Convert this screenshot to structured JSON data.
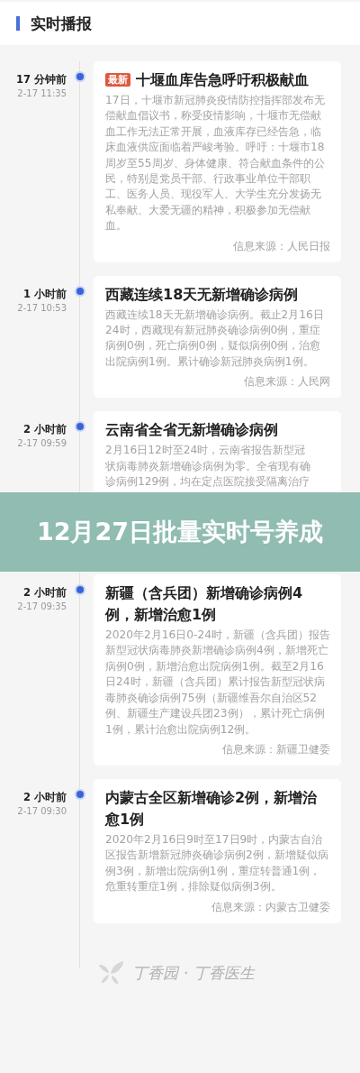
{
  "header": {
    "title": "实时播报"
  },
  "items": [
    {
      "time_ago": "17 分钟前",
      "timestamp": "2-17 11:35",
      "badge": "最新",
      "title": "十堰血库告急呼吁积极献血",
      "body_lines": [
        {
          "kind": "text",
          "text": "17日，十堰市新冠肺炎疫情防控指挥部发布无偿献血倡议书，称受疫情影响，十堰市无偿献血工作无法正常开展，血液库存已经告急，临床血液供应面临着严峻考验。呼吁：十堰市18周岁至55周岁、身体健康、符合献血条件的公民，特别是党员干部、行政事业单位干部职工、医务人员、现役军人、大学生充分发扬无私奉献、大爱无疆的精神，积极参加无偿献血。"
        }
      ],
      "source": "信息来源：人民日报"
    },
    {
      "time_ago": "1 小时前",
      "timestamp": "2-17 10:53",
      "title": "西藏连续18天无新增确诊病例",
      "body_lines": [
        {
          "kind": "text",
          "text": "西藏连续18天无新增确诊病例。截止2月16日24时，西藏现有新冠肺炎确诊病例0例，重症病例0例，死亡病例0例，疑似病例0例，治愈出院病例1例。累计确诊新冠肺炎病例1例。"
        }
      ],
      "source": "信息来源：人民网"
    },
    {
      "time_ago": "2 小时前",
      "timestamp": "2-17 09:59",
      "title": "云南省全省无新增确诊病例",
      "body_lines": [
        {
          "kind": "text",
          "text": " 2月16日12时至24时，云南省报告新型冠"
        },
        {
          "kind": "text",
          "text": "状病毒肺炎新增确诊病例为零。全省现有确"
        },
        {
          "kind": "text",
          "text": "诊病例129例，均在定点医院接受隔离治疗"
        },
        {
          "kind": "hidden"
        },
        {
          "kind": "hidden"
        },
        {
          "kind": "hidden"
        },
        {
          "kind": "hidden"
        }
      ]
    },
    {
      "time_ago": "2 小时前",
      "timestamp": "2-17 09:35",
      "title": "新疆（含兵团）新增确诊病例4例，新增治愈1例",
      "body_lines": [
        {
          "kind": "text",
          "text": "2020年2月16日0-24时，新疆（含兵团）报告新型冠状病毒肺炎新增确诊病例4例，新增死亡病例0例，新增治愈出院病例1例。截至2月16日24时，新疆（含兵团）累计报告新型冠状病毒肺炎确诊病例75例（新疆维吾尔自治区52例、新疆生产建设兵团23例），累计死亡病例1例，累计治愈出院病例12例。"
        }
      ],
      "source": "信息来源：新疆卫健委"
    },
    {
      "time_ago": "2 小时前",
      "timestamp": "2-17 09:30",
      "title": "内蒙古全区新增确诊2例，新增治愈1例",
      "body_lines": [
        {
          "kind": "text",
          "text": "2020年2月16日9时至17日9时，内蒙古自治区报告新增新冠肺炎确诊病例2例，新增疑似病例3例，新增出院病例1例，重症转普通1例，危重转重症1例，排除疑似病例3例。"
        }
      ],
      "source": "信息来源：内蒙古卫健委"
    }
  ],
  "footer": {
    "brand": "丁香园 · 丁香医生"
  },
  "overlay_banner": {
    "title": "12月27日批量实时号养成"
  }
}
